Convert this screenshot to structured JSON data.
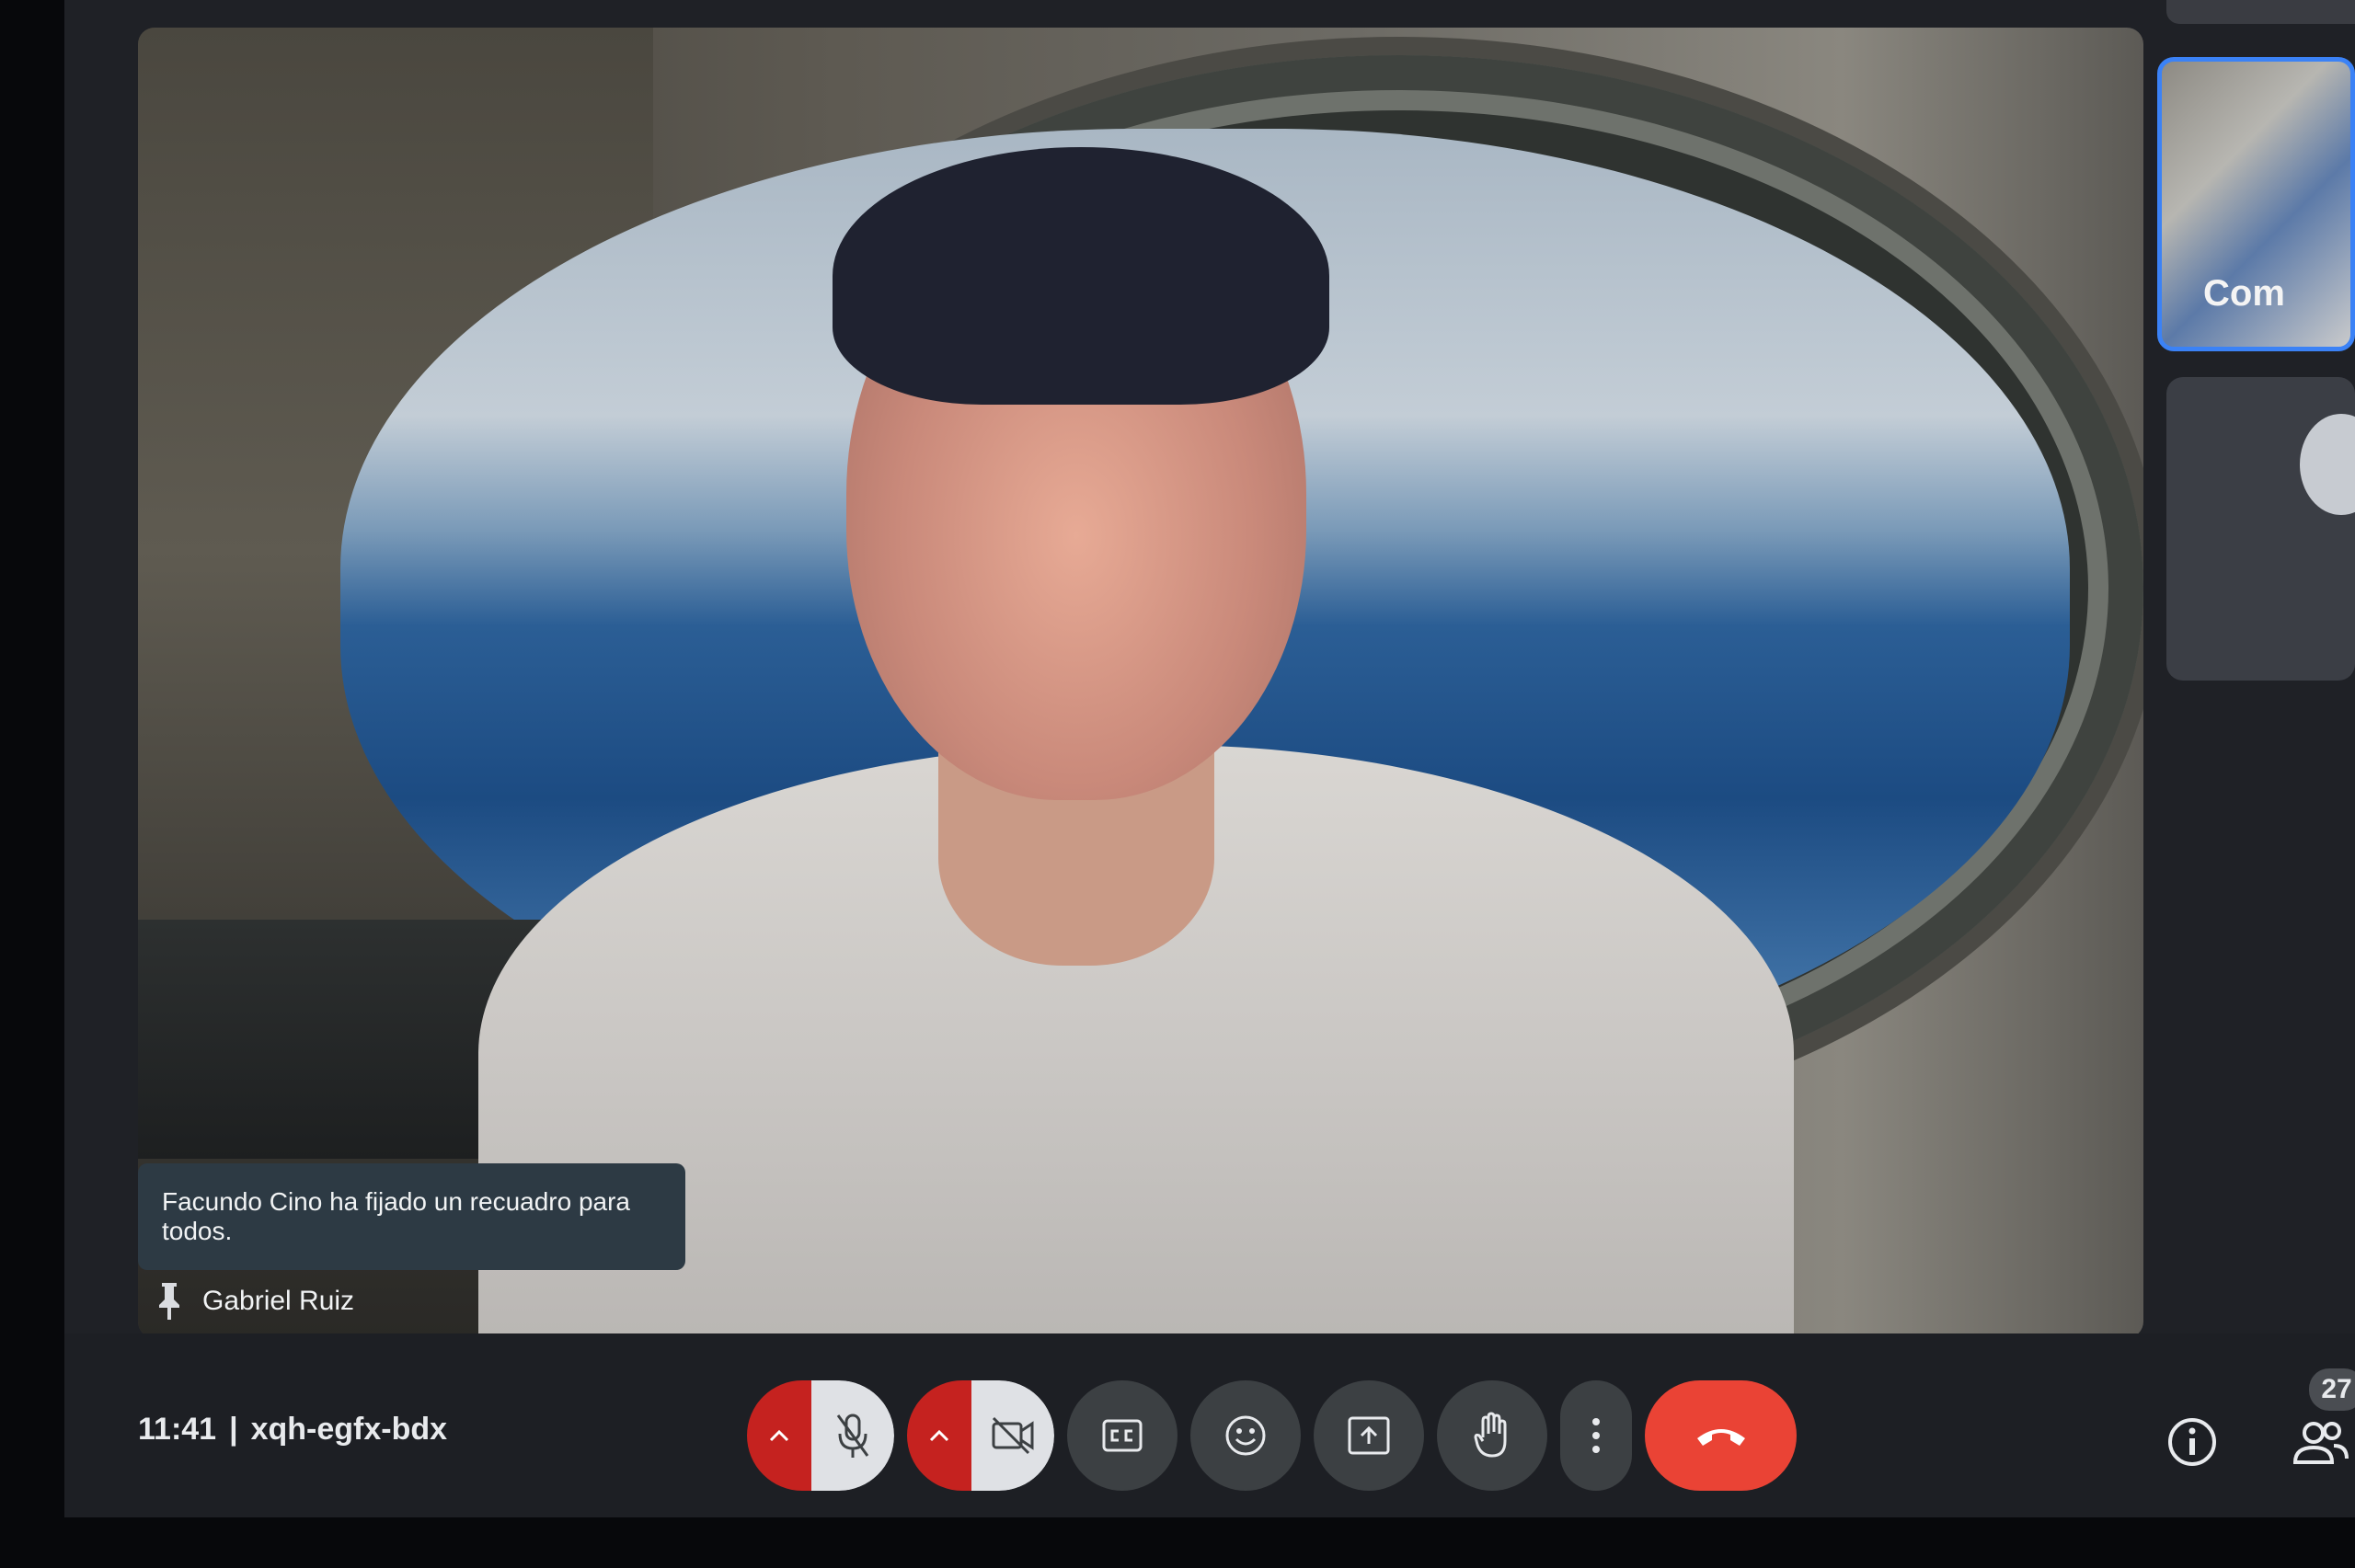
{
  "meeting": {
    "time": "11:41",
    "separator": "|",
    "code": "xqh-egfx-bdx"
  },
  "main_video": {
    "pin_notification": "Facundo Cino ha fijado un recuadro para todos.",
    "participant_name": "Gabriel Ruiz"
  },
  "filmstrip": {
    "thumb_1_text": "Com"
  },
  "controls": {
    "mic": {
      "state": "muted",
      "icon": "mic-off-icon"
    },
    "camera": {
      "state": "off",
      "icon": "videocam-off-icon"
    },
    "captions_icon": "closed-captions-icon",
    "reactions_icon": "emoji-icon",
    "present_icon": "present-screen-icon",
    "raise_hand_icon": "raise-hand-icon",
    "more_icon": "more-vert-icon",
    "hangup_icon": "call-end-icon"
  },
  "side_panel": {
    "info_icon": "info-icon",
    "people_icon": "people-icon",
    "people_count": "27"
  },
  "colors": {
    "hangup": "#ea4335",
    "caret_red": "#c5221f",
    "toggle_bg": "#dfe1e5",
    "btn_bg": "#3c4043",
    "active_border": "#3b82f6"
  }
}
